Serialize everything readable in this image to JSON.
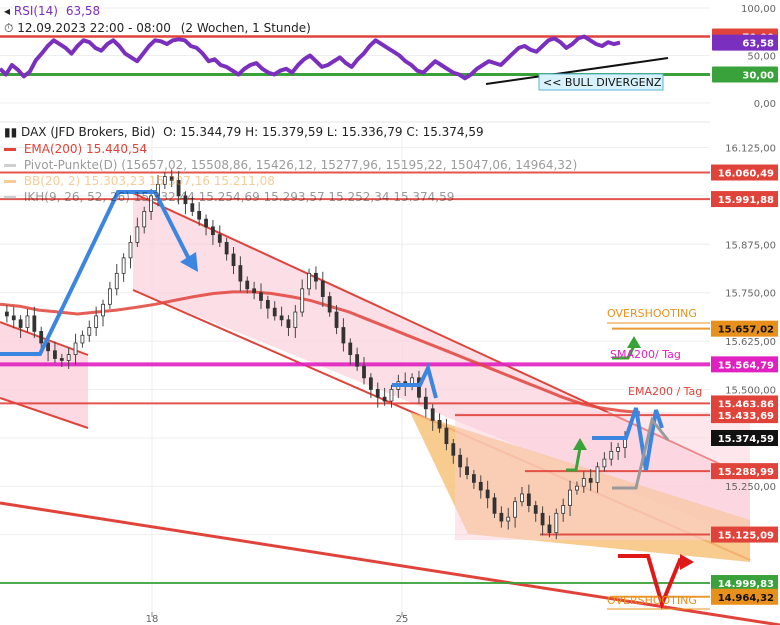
{
  "rsi_header": {
    "label": "RSI(14)",
    "value": "63,58",
    "date_line": "12.09.2023 22:00 - 08:00",
    "range": "(2 Wochen, 1 Stunde)",
    "color": "#7b2fbf"
  },
  "main_header": {
    "instrument": "DAX (JFD Brokers, Bid)",
    "ohlc": "O: 15.344,79  H: 15.379,59  L: 15.336,79  C: 15.374,59",
    "ema": "EMA(200)  15.440,54",
    "pivot": "Pivot-Punkte(D) (15657,02, 15508,86, 15426,12, 15277,96, 15195,22, 15047,06, 14964,32)",
    "bb": "BB(20, 2)  15.303,23  15.307,16  15.211,08",
    "ikh": "IKH(9, 26, 52, 26)  15.332,44  15.254,69  15.293,57  15.252,34  15.374,59"
  },
  "colors": {
    "ema": "#e0433a",
    "price_line": "#e0433a",
    "sma": "#e020c0",
    "channel_fill": "#fbd0dc",
    "wedge_fill": "#f7c27a",
    "rsi_line": "#7b2fbf",
    "rsi_30": "#3aa23a",
    "rsi_70": "#e0433a",
    "blue_arrow": "#3b86e0",
    "green_arrow": "#39a339",
    "red_arrow": "#e01818",
    "gray_arrow": "#9a9a9a",
    "overshoot": "#e8901c"
  },
  "annotations": {
    "bull_divergence": "<< BULL DIVERGENZ",
    "overshooting_top": "OVERSHOOTING",
    "overshooting_bottom": "OVERSHOOTING",
    "sma200_tag": "SMA200/ Tag",
    "ema200_tag": "EMA200 / Tag"
  },
  "chart_data": [
    {
      "type": "line",
      "name": "rsi",
      "ylim": [
        0,
        100
      ],
      "y_ticks": [
        "100,00",
        "70,00",
        "50,00",
        "30,00",
        "0,00"
      ],
      "levels": [
        70,
        30
      ],
      "current": 63.58,
      "tags": [
        {
          "value": 70,
          "label": "70,00",
          "color": "#e0433a"
        },
        {
          "value": 63.58,
          "label": "63,58",
          "color": "#7b2fbf"
        },
        {
          "value": 30,
          "label": "30,00",
          "color": "#3aa23a"
        }
      ],
      "values": [
        36,
        30,
        40,
        35,
        28,
        33,
        45,
        52,
        60,
        66,
        62,
        58,
        52,
        60,
        66,
        64,
        58,
        55,
        62,
        66,
        60,
        52,
        48,
        44,
        52,
        60,
        66,
        65,
        62,
        66,
        67,
        66,
        60,
        58,
        52,
        44,
        46,
        40,
        38,
        34,
        30,
        36,
        40,
        42,
        36,
        32,
        30,
        34,
        36,
        32,
        40,
        46,
        50,
        44,
        38,
        40,
        44,
        48,
        42,
        38,
        46,
        52,
        60,
        66,
        62,
        58,
        54,
        50,
        44,
        40,
        34,
        32,
        38,
        44,
        40,
        36,
        32,
        30,
        26,
        30,
        36,
        40,
        44,
        42,
        40,
        46,
        52,
        58,
        60,
        56,
        54,
        60,
        66,
        68,
        64,
        58,
        62,
        68,
        70,
        66,
        62,
        60,
        64,
        62,
        63.58
      ]
    },
    {
      "type": "candlestick",
      "name": "dax",
      "ylim": [
        14925,
        16160
      ],
      "y_ticks": [
        "16.125,00",
        "16.000,00",
        "15.875,00",
        "15.750,00",
        "15.625,00",
        "15.500,00",
        "15.375,00",
        "15.250,00",
        "15.125,00"
      ],
      "x_ticks": [
        "18",
        "25"
      ],
      "close_values": [
        15700,
        15690,
        15680,
        15660,
        15690,
        15650,
        15620,
        15600,
        15580,
        15575,
        15590,
        15620,
        15640,
        15660,
        15690,
        15720,
        15760,
        15800,
        15840,
        15880,
        15920,
        15960,
        16000,
        16030,
        16050,
        16040,
        16000,
        15980,
        15960,
        15940,
        15920,
        15900,
        15880,
        15850,
        15820,
        15780,
        15760,
        15750,
        15730,
        15710,
        15690,
        15680,
        15660,
        15700,
        15760,
        15800,
        15780,
        15740,
        15700,
        15660,
        15620,
        15590,
        15560,
        15530,
        15500,
        15480,
        15470,
        15500,
        15520,
        15510,
        15530,
        15480,
        15450,
        15420,
        15400,
        15360,
        15330,
        15300,
        15280,
        15260,
        15240,
        15220,
        15180,
        15160,
        15170,
        15210,
        15230,
        15200,
        15180,
        15150,
        15130,
        15180,
        15200,
        15240,
        15250,
        15270,
        15260,
        15300,
        15320,
        15340,
        15350,
        15374.59
      ],
      "horizontal_levels": [
        {
          "value": 16060.49,
          "label": "16.060,49",
          "color": "#e0433a"
        },
        {
          "value": 15991.88,
          "label": "15.991,88",
          "color": "#e0433a"
        },
        {
          "value": 15657.02,
          "label": "15.657,02",
          "color": "#e8901c"
        },
        {
          "value": 15564.79,
          "label": "15.564,79",
          "color": "#e020c0"
        },
        {
          "value": 15463.86,
          "label": "15.463,86",
          "color": "#e0433a"
        },
        {
          "value": 15433.69,
          "label": "15.433,69",
          "color": "#e0433a"
        },
        {
          "value": 15374.59,
          "label": "15.374,59",
          "color": "#111111"
        },
        {
          "value": 15288.99,
          "label": "15.288,99",
          "color": "#e0433a"
        },
        {
          "value": 15125.09,
          "label": "15.125,09",
          "color": "#e0433a"
        },
        {
          "value": 14999.83,
          "label": "14.999,83",
          "color": "#3aa23a"
        },
        {
          "value": 14964.32,
          "label": "14.964,32",
          "color": "#e8901c"
        }
      ],
      "ema200": [
        15720,
        15715,
        15705,
        15700,
        15695,
        15700,
        15705,
        15712,
        15720,
        15730,
        15740,
        15748,
        15752,
        15752,
        15748,
        15740,
        15730,
        15715,
        15700,
        15680,
        15660,
        15640,
        15620,
        15600,
        15580,
        15560,
        15540,
        15520,
        15500,
        15480,
        15463,
        15452,
        15445,
        15440.54
      ]
    }
  ]
}
